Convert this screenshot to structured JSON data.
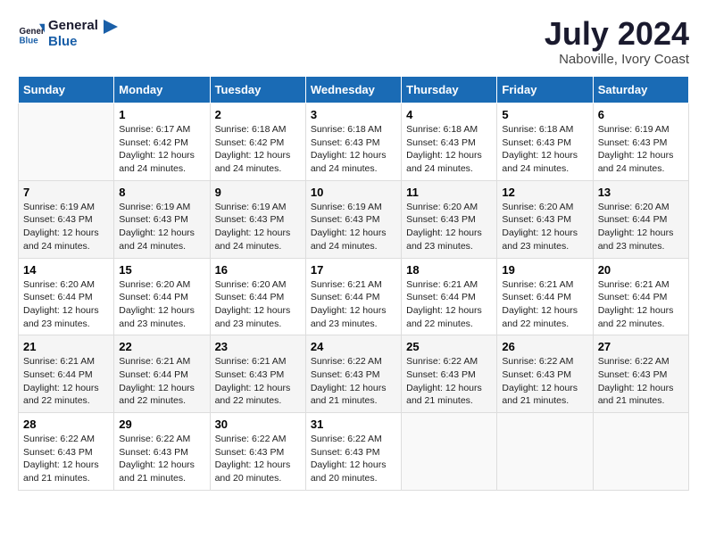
{
  "logo": {
    "line1": "General",
    "line2": "Blue"
  },
  "title": "July 2024",
  "location": "Naboville, Ivory Coast",
  "days_of_week": [
    "Sunday",
    "Monday",
    "Tuesday",
    "Wednesday",
    "Thursday",
    "Friday",
    "Saturday"
  ],
  "weeks": [
    [
      {
        "day": "",
        "sunrise": "",
        "sunset": "",
        "daylight": ""
      },
      {
        "day": "1",
        "sunrise": "6:17 AM",
        "sunset": "6:42 PM",
        "daylight": "12 hours and 24 minutes."
      },
      {
        "day": "2",
        "sunrise": "6:18 AM",
        "sunset": "6:42 PM",
        "daylight": "12 hours and 24 minutes."
      },
      {
        "day": "3",
        "sunrise": "6:18 AM",
        "sunset": "6:43 PM",
        "daylight": "12 hours and 24 minutes."
      },
      {
        "day": "4",
        "sunrise": "6:18 AM",
        "sunset": "6:43 PM",
        "daylight": "12 hours and 24 minutes."
      },
      {
        "day": "5",
        "sunrise": "6:18 AM",
        "sunset": "6:43 PM",
        "daylight": "12 hours and 24 minutes."
      },
      {
        "day": "6",
        "sunrise": "6:19 AM",
        "sunset": "6:43 PM",
        "daylight": "12 hours and 24 minutes."
      }
    ],
    [
      {
        "day": "7",
        "sunrise": "6:19 AM",
        "sunset": "6:43 PM",
        "daylight": "12 hours and 24 minutes."
      },
      {
        "day": "8",
        "sunrise": "6:19 AM",
        "sunset": "6:43 PM",
        "daylight": "12 hours and 24 minutes."
      },
      {
        "day": "9",
        "sunrise": "6:19 AM",
        "sunset": "6:43 PM",
        "daylight": "12 hours and 24 minutes."
      },
      {
        "day": "10",
        "sunrise": "6:19 AM",
        "sunset": "6:43 PM",
        "daylight": "12 hours and 24 minutes."
      },
      {
        "day": "11",
        "sunrise": "6:20 AM",
        "sunset": "6:43 PM",
        "daylight": "12 hours and 23 minutes."
      },
      {
        "day": "12",
        "sunrise": "6:20 AM",
        "sunset": "6:43 PM",
        "daylight": "12 hours and 23 minutes."
      },
      {
        "day": "13",
        "sunrise": "6:20 AM",
        "sunset": "6:44 PM",
        "daylight": "12 hours and 23 minutes."
      }
    ],
    [
      {
        "day": "14",
        "sunrise": "6:20 AM",
        "sunset": "6:44 PM",
        "daylight": "12 hours and 23 minutes."
      },
      {
        "day": "15",
        "sunrise": "6:20 AM",
        "sunset": "6:44 PM",
        "daylight": "12 hours and 23 minutes."
      },
      {
        "day": "16",
        "sunrise": "6:20 AM",
        "sunset": "6:44 PM",
        "daylight": "12 hours and 23 minutes."
      },
      {
        "day": "17",
        "sunrise": "6:21 AM",
        "sunset": "6:44 PM",
        "daylight": "12 hours and 23 minutes."
      },
      {
        "day": "18",
        "sunrise": "6:21 AM",
        "sunset": "6:44 PM",
        "daylight": "12 hours and 22 minutes."
      },
      {
        "day": "19",
        "sunrise": "6:21 AM",
        "sunset": "6:44 PM",
        "daylight": "12 hours and 22 minutes."
      },
      {
        "day": "20",
        "sunrise": "6:21 AM",
        "sunset": "6:44 PM",
        "daylight": "12 hours and 22 minutes."
      }
    ],
    [
      {
        "day": "21",
        "sunrise": "6:21 AM",
        "sunset": "6:44 PM",
        "daylight": "12 hours and 22 minutes."
      },
      {
        "day": "22",
        "sunrise": "6:21 AM",
        "sunset": "6:44 PM",
        "daylight": "12 hours and 22 minutes."
      },
      {
        "day": "23",
        "sunrise": "6:21 AM",
        "sunset": "6:43 PM",
        "daylight": "12 hours and 22 minutes."
      },
      {
        "day": "24",
        "sunrise": "6:22 AM",
        "sunset": "6:43 PM",
        "daylight": "12 hours and 21 minutes."
      },
      {
        "day": "25",
        "sunrise": "6:22 AM",
        "sunset": "6:43 PM",
        "daylight": "12 hours and 21 minutes."
      },
      {
        "day": "26",
        "sunrise": "6:22 AM",
        "sunset": "6:43 PM",
        "daylight": "12 hours and 21 minutes."
      },
      {
        "day": "27",
        "sunrise": "6:22 AM",
        "sunset": "6:43 PM",
        "daylight": "12 hours and 21 minutes."
      }
    ],
    [
      {
        "day": "28",
        "sunrise": "6:22 AM",
        "sunset": "6:43 PM",
        "daylight": "12 hours and 21 minutes."
      },
      {
        "day": "29",
        "sunrise": "6:22 AM",
        "sunset": "6:43 PM",
        "daylight": "12 hours and 21 minutes."
      },
      {
        "day": "30",
        "sunrise": "6:22 AM",
        "sunset": "6:43 PM",
        "daylight": "12 hours and 20 minutes."
      },
      {
        "day": "31",
        "sunrise": "6:22 AM",
        "sunset": "6:43 PM",
        "daylight": "12 hours and 20 minutes."
      },
      {
        "day": "",
        "sunrise": "",
        "sunset": "",
        "daylight": ""
      },
      {
        "day": "",
        "sunrise": "",
        "sunset": "",
        "daylight": ""
      },
      {
        "day": "",
        "sunrise": "",
        "sunset": "",
        "daylight": ""
      }
    ]
  ],
  "labels": {
    "sunrise_prefix": "Sunrise: ",
    "sunset_prefix": "Sunset: ",
    "daylight_prefix": "Daylight: "
  }
}
